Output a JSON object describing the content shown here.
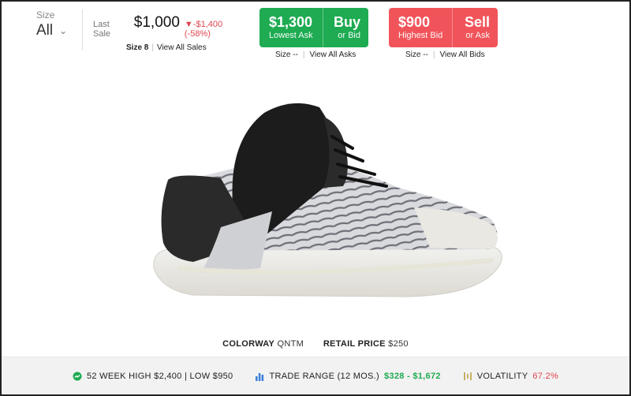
{
  "size_selector": {
    "label": "Size",
    "value": "All"
  },
  "last_sale": {
    "label": "Last Sale",
    "price": "$1,000",
    "change": "▼-$1,400 (-58%)",
    "size_text": "Size 8",
    "view_all": "View All Sales"
  },
  "buy": {
    "price": "$1,300",
    "price_label": "Lowest Ask",
    "action": "Buy",
    "action_sub": "or Bid",
    "size_text": "Size --",
    "view_all": "View All Asks",
    "color": "#1eab52"
  },
  "sell": {
    "price": "$900",
    "price_label": "Highest Bid",
    "action": "Sell",
    "action_sub": "or Ask",
    "size_text": "Size --",
    "view_all": "View All Bids",
    "color": "#f0545a"
  },
  "details": {
    "colorway_key": "COLORWAY",
    "colorway_val": "QNTM",
    "retail_key": "RETAIL PRICE",
    "retail_val": "$250"
  },
  "stats": {
    "week52_label": "52 WEEK HIGH $2,400 | LOW $950",
    "trade_range_label": "TRADE RANGE (12 MOS.)",
    "trade_range_value": "$328 - $1,672",
    "volatility_label": "VOLATILITY",
    "volatility_value": "67.2%"
  },
  "icons": {
    "week52": "trend-circle-icon",
    "trade_range": "bar-chart-icon",
    "volatility": "volatility-icon"
  }
}
